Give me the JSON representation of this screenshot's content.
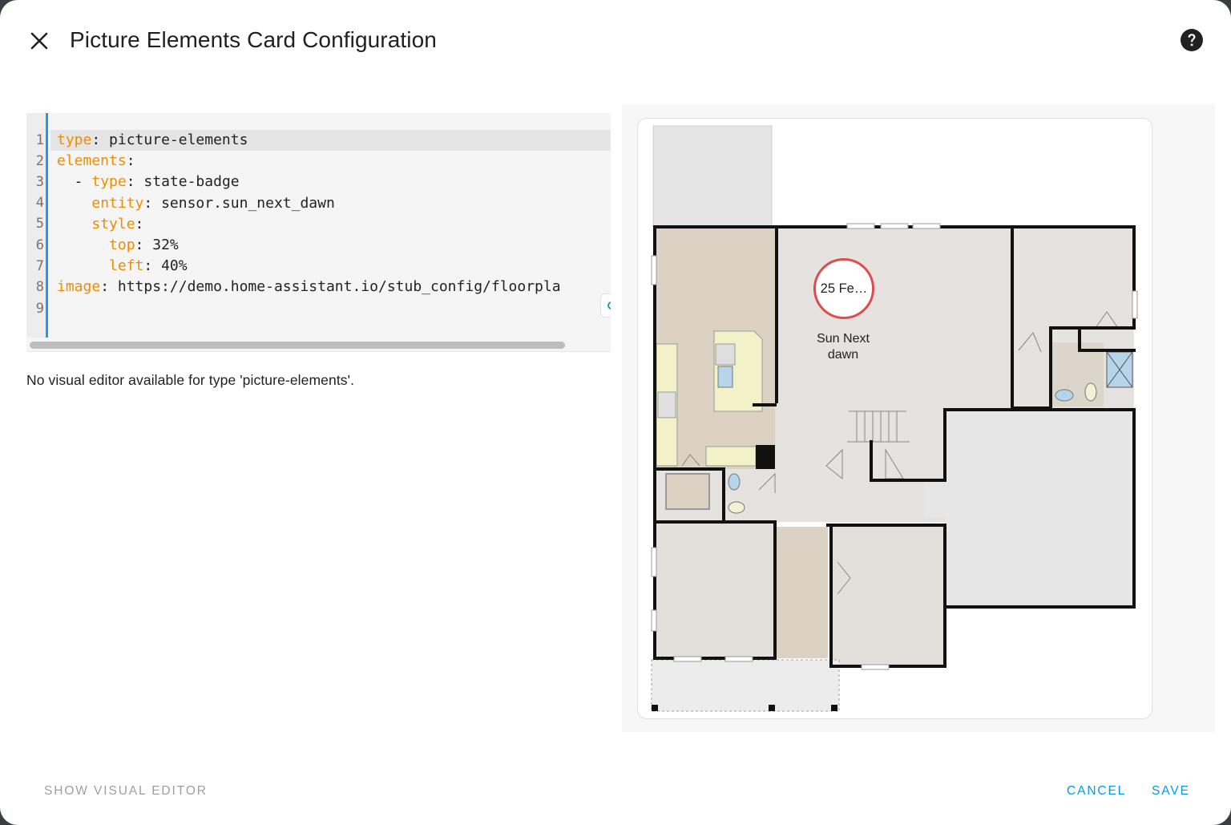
{
  "dialog": {
    "title": "Picture Elements Card Configuration",
    "close_icon": "close-icon",
    "help_icon": "help-circle-icon"
  },
  "editor": {
    "line_numbers": [
      "1",
      "2",
      "3",
      "4",
      "5",
      "6",
      "7",
      "8",
      "9"
    ],
    "lines": [
      {
        "key": "type",
        "sep": ": ",
        "value": "picture-elements",
        "indent": ""
      },
      {
        "key": "elements",
        "sep": ":",
        "value": "",
        "indent": ""
      },
      {
        "key": "type",
        "sep": ": ",
        "value": "state-badge",
        "indent": "  - "
      },
      {
        "key": "entity",
        "sep": ": ",
        "value": "sensor.sun_next_dawn",
        "indent": "    "
      },
      {
        "key": "style",
        "sep": ":",
        "value": "",
        "indent": "    "
      },
      {
        "key": "top",
        "sep": ": ",
        "value": "32%",
        "indent": "      "
      },
      {
        "key": "left",
        "sep": ": ",
        "value": "40%",
        "indent": "      "
      },
      {
        "key": "image",
        "sep": ": ",
        "value": "https://demo.home-assistant.io/stub_config/floorpla",
        "indent": ""
      },
      {
        "key": "",
        "sep": "",
        "value": "",
        "indent": ""
      }
    ]
  },
  "message": "No visual editor available for type 'picture-elements'.",
  "preview": {
    "badge_value": "25 Fe…",
    "badge_label_line1": "Sun Next",
    "badge_label_line2": "dawn",
    "badge_border_color": "#df4c4b"
  },
  "footer": {
    "show_visual_editor": "Show visual editor",
    "cancel": "Cancel",
    "save": "Save"
  },
  "colors": {
    "accent": "#039be5",
    "gutter_border": "#2196f3",
    "yaml_key": "#f08c00"
  }
}
